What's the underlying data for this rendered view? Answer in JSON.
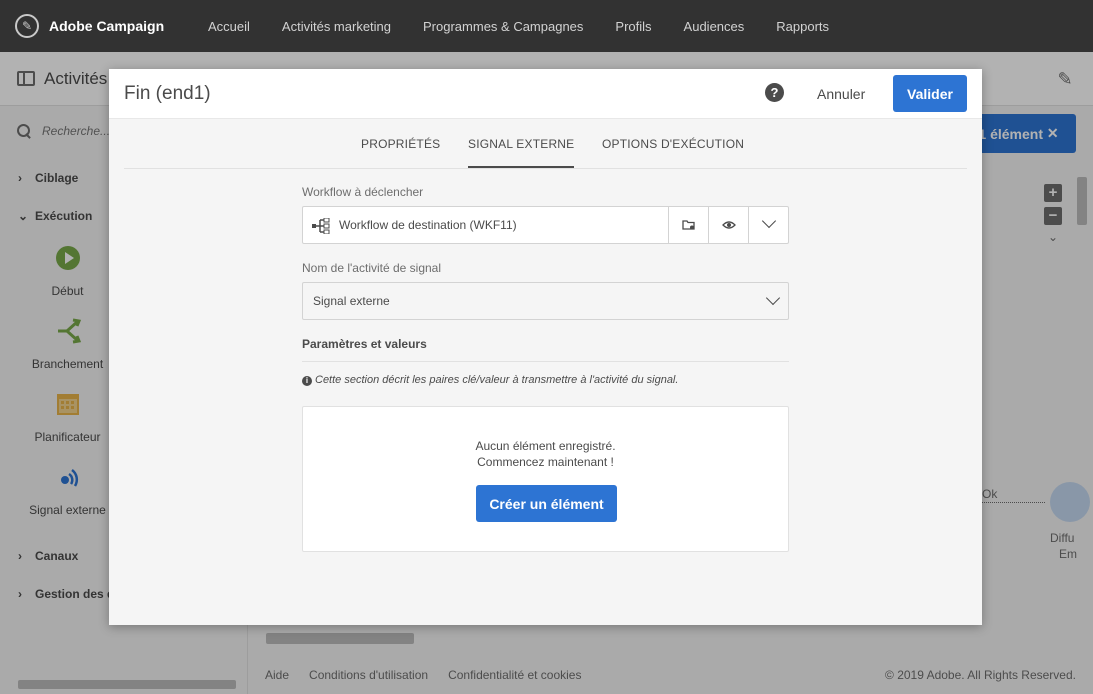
{
  "app": {
    "name": "Adobe Campaign"
  },
  "nav": {
    "items": [
      "Accueil",
      "Activités marketing",
      "Programmes & Campagnes",
      "Profils",
      "Audiences",
      "Rapports"
    ]
  },
  "page": {
    "title": "Activités"
  },
  "palette": {
    "search_placeholder": "Recherche...",
    "categories": {
      "targeting": "Ciblage",
      "execution": "Exécution",
      "channels": "Canaux",
      "data_management": "Gestion des d"
    },
    "items": [
      "Début",
      "Branchement",
      "Planificateur",
      "Signal externe"
    ]
  },
  "canvas": {
    "selection_badge": "1 élément",
    "transition_label": "Ok",
    "delivery_node_label_1": "Diffu",
    "delivery_node_label_2": "Em"
  },
  "footer": {
    "links": [
      "Aide",
      "Conditions d'utilisation",
      "Confidentialité et cookies"
    ],
    "copyright": "© 2019 Adobe. All Rights Reserved."
  },
  "modal": {
    "title": "Fin (end1)",
    "help": "?",
    "cancel_label": "Annuler",
    "validate_label": "Valider",
    "tabs": [
      "PROPRIÉTÉS",
      "SIGNAL EXTERNE",
      "OPTIONS D'EXÉCUTION"
    ],
    "active_tab_index": 1,
    "workflow": {
      "label": "Workflow à déclencher",
      "value": "Workflow de destination (WKF11)"
    },
    "signal": {
      "label": "Nom de l'activité de signal",
      "value": "Signal externe"
    },
    "params": {
      "title": "Paramètres et valeurs",
      "info": "Cette section décrit les paires clé/valeur à transmettre à l'activité du signal.",
      "empty_line_1": "Aucun élément enregistré.",
      "empty_line_2": "Commencez maintenant !",
      "create_label": "Créer un élément"
    }
  },
  "colors": {
    "accent": "#2d74d3",
    "topbar": "#323232"
  }
}
